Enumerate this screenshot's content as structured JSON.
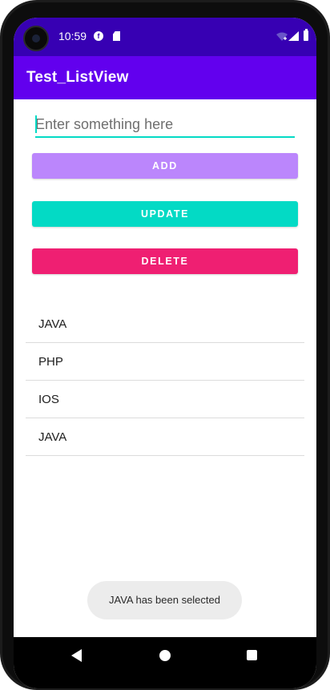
{
  "status_bar": {
    "time": "10:59",
    "notification_icons": [
      "f-icon",
      "sd-card-icon"
    ],
    "system_icons": [
      "wifi-icon",
      "signal-icon",
      "battery-icon"
    ],
    "background_color": "#3700b3"
  },
  "app_bar": {
    "title": "Test_ListView",
    "background_color": "#6200ee"
  },
  "input": {
    "value": "",
    "placeholder": "Enter something here",
    "accent_color": "#03dac5"
  },
  "buttons": {
    "add": {
      "label": "ADD",
      "color": "#bb86fc"
    },
    "update": {
      "label": "UPDATE",
      "color": "#03dac5"
    },
    "delete": {
      "label": "DELETE",
      "color": "#ef1f72"
    }
  },
  "list": {
    "items": [
      "JAVA",
      "PHP",
      "IOS",
      "JAVA"
    ]
  },
  "toast": {
    "message": "JAVA has been selected"
  },
  "nav_bar": {
    "buttons": [
      "back-icon",
      "home-icon",
      "recents-icon"
    ]
  }
}
